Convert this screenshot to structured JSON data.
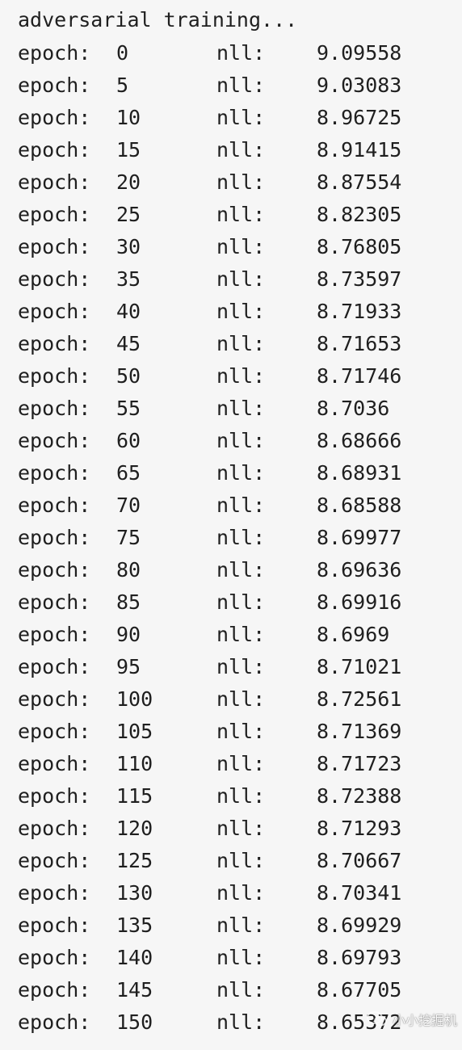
{
  "header_text": "adversarial training...",
  "labels": {
    "epoch": "epoch:",
    "nll": "nll:"
  },
  "rows": [
    {
      "epoch": "0",
      "nll": "9.09558"
    },
    {
      "epoch": "5",
      "nll": "9.03083"
    },
    {
      "epoch": "10",
      "nll": "8.96725"
    },
    {
      "epoch": "15",
      "nll": "8.91415"
    },
    {
      "epoch": "20",
      "nll": "8.87554"
    },
    {
      "epoch": "25",
      "nll": "8.82305"
    },
    {
      "epoch": "30",
      "nll": "8.76805"
    },
    {
      "epoch": "35",
      "nll": "8.73597"
    },
    {
      "epoch": "40",
      "nll": "8.71933"
    },
    {
      "epoch": "45",
      "nll": "8.71653"
    },
    {
      "epoch": "50",
      "nll": "8.71746"
    },
    {
      "epoch": "55",
      "nll": "8.7036"
    },
    {
      "epoch": "60",
      "nll": "8.68666"
    },
    {
      "epoch": "65",
      "nll": "8.68931"
    },
    {
      "epoch": "70",
      "nll": "8.68588"
    },
    {
      "epoch": "75",
      "nll": "8.69977"
    },
    {
      "epoch": "80",
      "nll": "8.69636"
    },
    {
      "epoch": "85",
      "nll": "8.69916"
    },
    {
      "epoch": "90",
      "nll": "8.6969"
    },
    {
      "epoch": "95",
      "nll": "8.71021"
    },
    {
      "epoch": "100",
      "nll": "8.72561"
    },
    {
      "epoch": "105",
      "nll": "8.71369"
    },
    {
      "epoch": "110",
      "nll": "8.71723"
    },
    {
      "epoch": "115",
      "nll": "8.72388"
    },
    {
      "epoch": "120",
      "nll": "8.71293"
    },
    {
      "epoch": "125",
      "nll": "8.70667"
    },
    {
      "epoch": "130",
      "nll": "8.70341"
    },
    {
      "epoch": "135",
      "nll": "8.69929"
    },
    {
      "epoch": "140",
      "nll": "8.69793"
    },
    {
      "epoch": "145",
      "nll": "8.67705"
    },
    {
      "epoch": "150",
      "nll": "8.65372"
    }
  ],
  "watermark": {
    "text": "小小挖掘机",
    "icon": "wechat-icon"
  },
  "colors": {
    "background": "#f6f6f6",
    "text": "#1f1f1f"
  }
}
